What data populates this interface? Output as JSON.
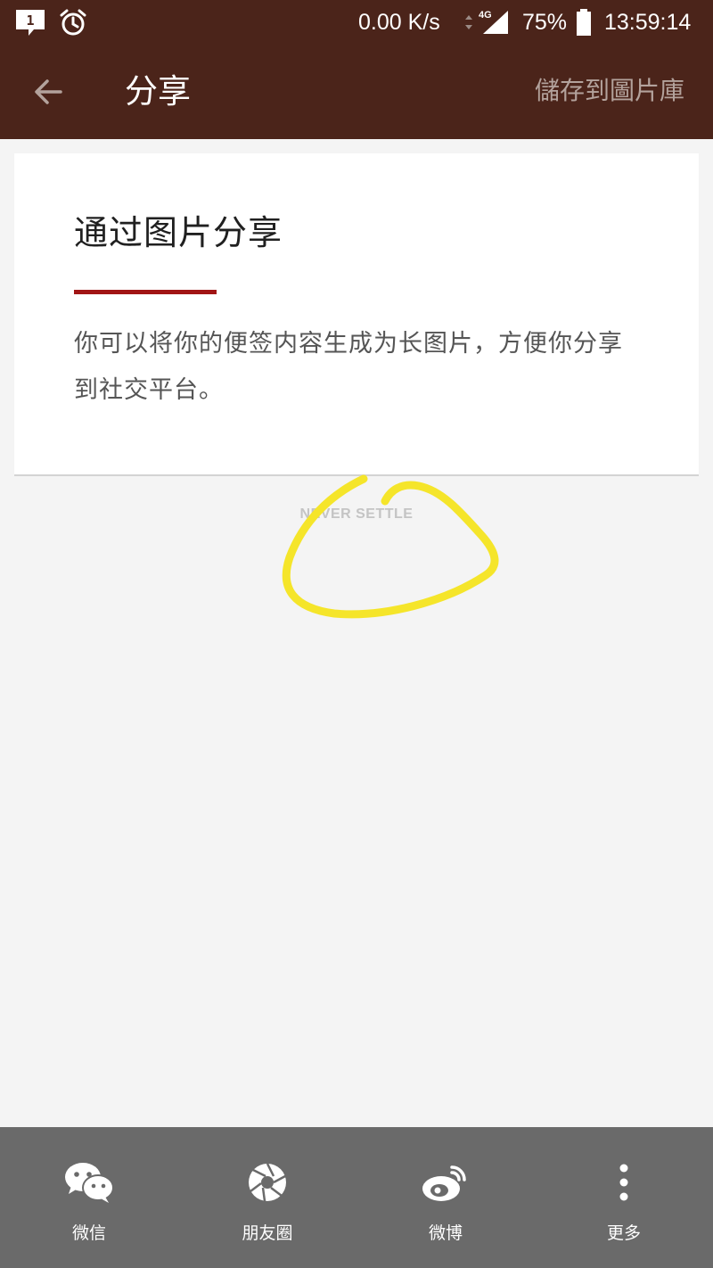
{
  "status_bar": {
    "notification_count": "1",
    "network_speed": "0.00 K/s",
    "network_type": "4G",
    "battery_percent": "75%",
    "time": "13:59:14",
    "icons": [
      "notification-icon",
      "alarm-icon",
      "data-arrows-icon",
      "signal-icon",
      "battery-icon"
    ]
  },
  "toolbar": {
    "back_icon": "arrow-left-icon",
    "title": "分享",
    "save_label": "儲存到圖片庫"
  },
  "card": {
    "title": "通过图片分享",
    "description": "你可以将你的便签内容生成为长图片，方便你分享到社交平台。"
  },
  "watermark": "NEVER SETTLE",
  "share_bar": {
    "items": [
      {
        "label": "微信",
        "icon": "wechat-icon"
      },
      {
        "label": "朋友圈",
        "icon": "moments-icon"
      },
      {
        "label": "微博",
        "icon": "weibo-icon"
      },
      {
        "label": "更多",
        "icon": "more-vertical-icon"
      }
    ]
  },
  "colors": {
    "header": "#4b241a",
    "accent": "#a11515",
    "background": "#f4f4f4",
    "share_bar": "#6a6a6a",
    "annotation": "#f5e52a"
  }
}
